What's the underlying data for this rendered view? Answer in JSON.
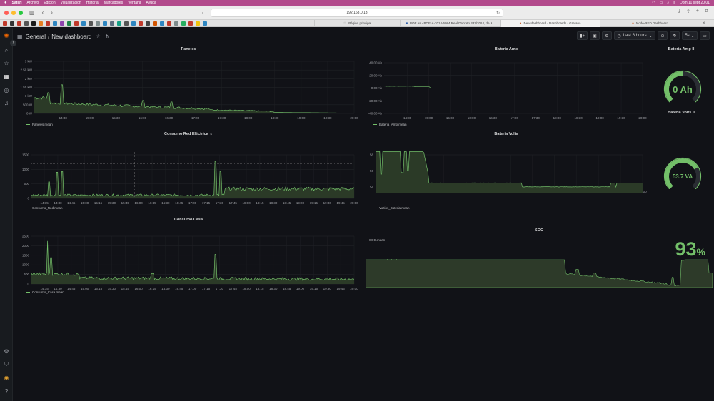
{
  "menubar": {
    "app": "Safari",
    "items": [
      "Archivo",
      "Edición",
      "Visualización",
      "Historial",
      "Marcadores",
      "Ventana",
      "Ayuda"
    ],
    "datetime": "Dom 11 sept  20:01"
  },
  "browser": {
    "url": "192.168.0.13",
    "tabs": [
      {
        "label": "Página principal"
      },
      {
        "label": "BOE.es - BOE-A-2014-6084 Real Decreto 337/2014, de 9..."
      },
      {
        "label": "New dashboard - Dashboards - Grafana"
      },
      {
        "label": "Node-RED Dashboard"
      }
    ]
  },
  "grafana": {
    "breadcrumb": [
      "General",
      "New dashboard"
    ],
    "time_range": "Last 6 hours",
    "refresh": "5s"
  },
  "panels": {
    "paneles": {
      "title": "Paneles",
      "legend": "Paneles.mean",
      "yticks": [
        "3 kW",
        "2.50 kW",
        "2 kW",
        "1.50 kW",
        "1 kW",
        "500 W",
        "0 W"
      ],
      "xticks": [
        "14:30",
        "15:00",
        "15:30",
        "16:00",
        "16:30",
        "17:00",
        "17:30",
        "18:00",
        "18:30",
        "19:00",
        "19:30",
        "20:00"
      ]
    },
    "bateria_amp": {
      "title": "Bateria Amp",
      "legend": "Bateria_Amp.mean",
      "yticks": [
        "40.00 Ah",
        "20.00 Ah",
        "0.00 Ah",
        "-20.00 Ah",
        "-40.00 Ah"
      ],
      "xticks": [
        "14:30",
        "15:00",
        "15:30",
        "16:00",
        "16:30",
        "17:00",
        "17:30",
        "18:00",
        "18:30",
        "19:00",
        "19:30",
        "20:00"
      ]
    },
    "bateria_amp_ii": {
      "title": "Bateria Amp II",
      "value": "0 Ah",
      "fraction": 0.5
    },
    "consumo_red": {
      "title": "Consumo Red Eléctrica",
      "legend": "Consumo_Red.mean",
      "yticks": [
        "1500",
        "1000",
        "500",
        "0"
      ],
      "xticks": [
        "14:15",
        "14:30",
        "14:45",
        "15:00",
        "15:15",
        "15:30",
        "15:45",
        "16:00",
        "16:15",
        "16:30",
        "16:45",
        "17:00",
        "17:15",
        "17:30",
        "17:45",
        "18:00",
        "18:15",
        "18:30",
        "18:45",
        "19:00",
        "19:15",
        "19:30",
        "19:45",
        "20:00"
      ]
    },
    "bateria_volts": {
      "title": "Bateria Volts",
      "legend": "Voltios_Bateria.mean",
      "yticks": [
        "58",
        "56",
        "54"
      ],
      "xticks": [
        "14:30",
        "15:00",
        "15:30",
        "16:00",
        "16:30",
        "17:00",
        "17:30",
        "18:00",
        "18:30",
        "19:00",
        "19:30",
        "20:00"
      ]
    },
    "bateria_volts_ii": {
      "title": "Bateria Volts II",
      "value": "53.7 VA",
      "fraction": 0.72
    },
    "consumo_casa": {
      "title": "Consumo Casa",
      "legend": "Consumo_Casa.mean",
      "yticks": [
        "2500",
        "2000",
        "1500",
        "1000",
        "500",
        "0"
      ],
      "xticks": [
        "14:15",
        "14:30",
        "14:45",
        "15:00",
        "15:15",
        "15:30",
        "15:45",
        "16:00",
        "16:15",
        "16:30",
        "16:45",
        "17:00",
        "17:15",
        "17:30",
        "17:45",
        "18:00",
        "18:15",
        "18:30",
        "18:45",
        "19:00",
        "19:15",
        "19:30",
        "19:45",
        "20:00"
      ]
    },
    "soc": {
      "title": "SOC",
      "legend": "SOC.mean",
      "value": "93",
      "unit": "%"
    }
  },
  "colors": {
    "series": "#73bf69",
    "fill": "#2b3a27",
    "bg": "#111217",
    "menubar": "#b24a8c"
  }
}
